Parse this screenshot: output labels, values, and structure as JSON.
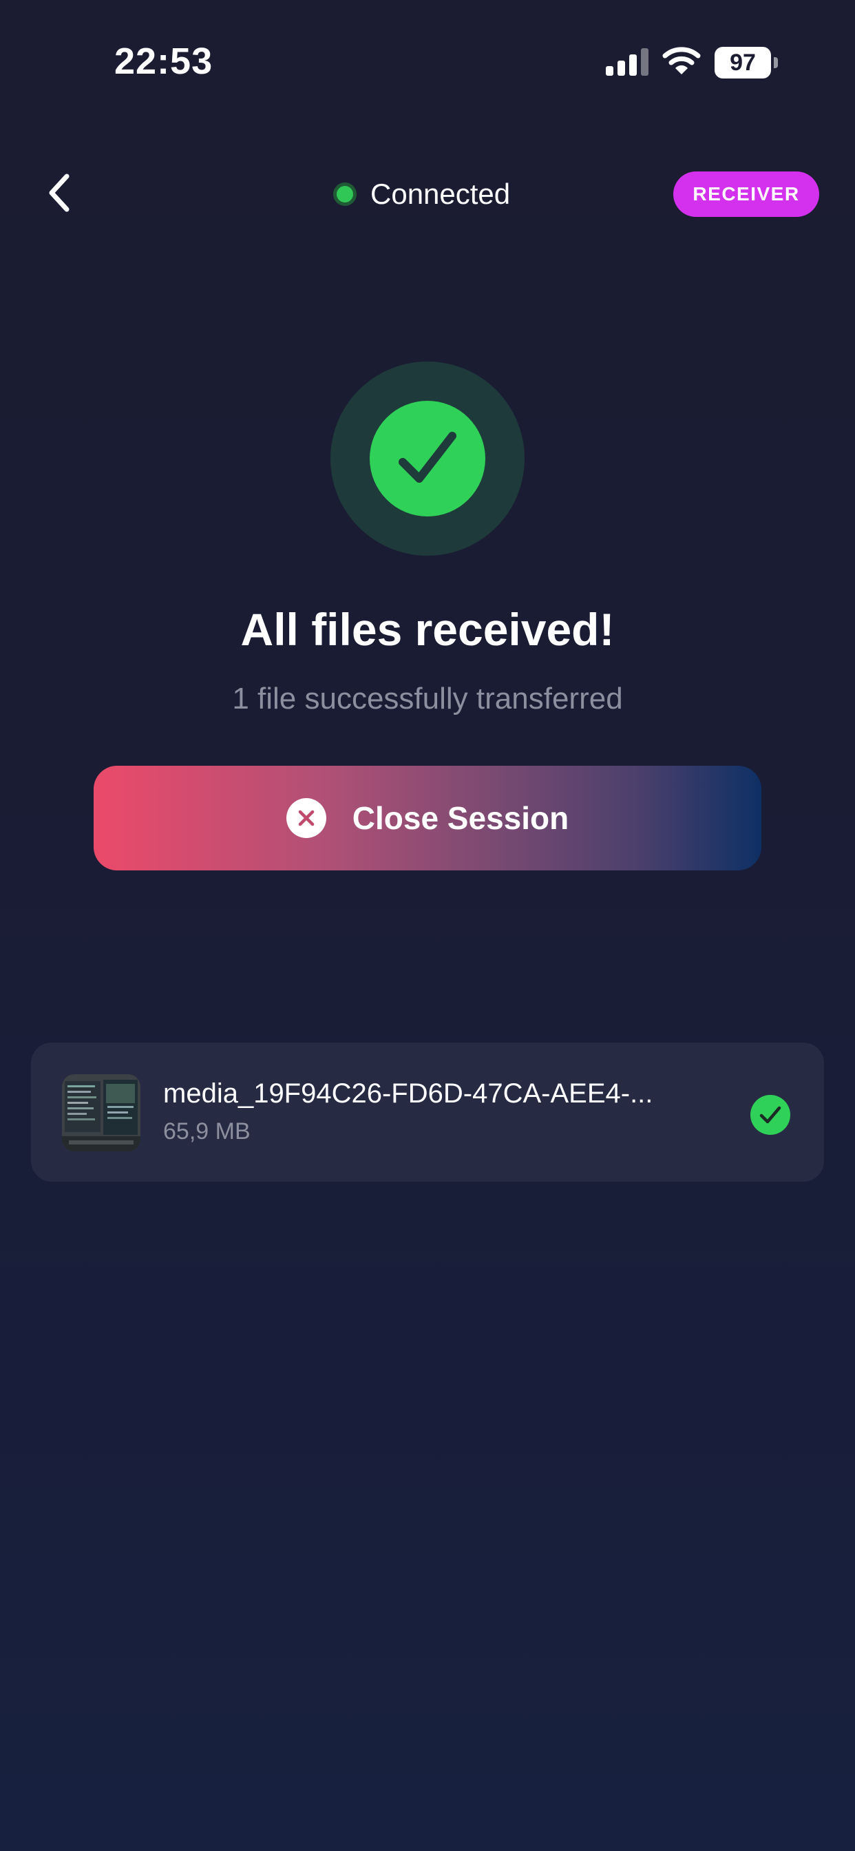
{
  "status_bar": {
    "time": "22:53",
    "battery_level": "97",
    "icons": [
      "cellular-signal-icon",
      "wifi-icon",
      "battery-icon"
    ]
  },
  "header": {
    "back_icon": "chevron-left-icon",
    "connection_label": "Connected",
    "role_badge": "RECEIVER"
  },
  "result": {
    "icon": "checkmark-icon",
    "headline": "All files received!",
    "subline": "1 file successfully transferred"
  },
  "actions": {
    "close_session_label": "Close Session",
    "close_icon": "close-circle-icon"
  },
  "files": [
    {
      "name": "media_19F94C26-FD6D-47CA-AEE4-...",
      "size": "65,9 MB",
      "status_icon": "checkmark-circle-icon"
    }
  ],
  "colors": {
    "background": "#1b1c31",
    "accent_green": "#30d158",
    "badge_magenta": "#d431ee",
    "button_gradient_start": "#eb4a6a",
    "button_gradient_end": "#0e3064",
    "card_background": "#262a43",
    "secondary_text": "#8e8f9e"
  }
}
